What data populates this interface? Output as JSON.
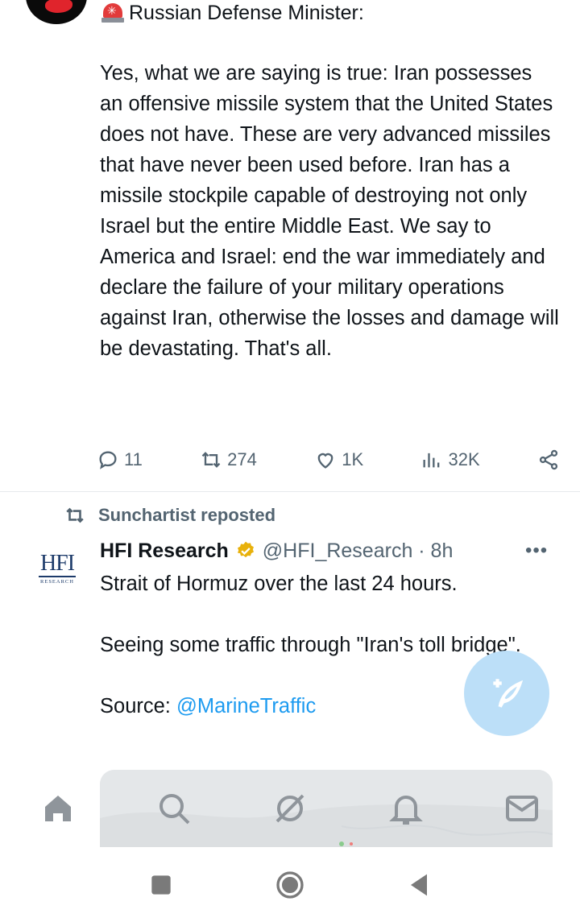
{
  "tweet1": {
    "author_line": "Russian Defense Minister:",
    "body": "Yes, what we are saying is true: Iran possesses an offensive missile system that the United States does not have. These are very advanced missiles that have never been used before. Iran has a missile stockpile capable of destroying not only Israel but the entire Middle East. We say to America and Israel: end the war immediately and declare the failure of your military operations against Iran, otherwise the losses and damage will be devastating. That's all.",
    "replies": "11",
    "reposts": "274",
    "likes": "1K",
    "views": "32K"
  },
  "tweet2": {
    "repost_label": "Sunchartist reposted",
    "name": "HFI Research",
    "handle": "@HFI_Research · 8h",
    "logo_text": "HFI",
    "logo_sub": "RESEARCH",
    "body_line1": "Strait of Hormuz over the last 24 hours.",
    "body_line2": "Seeing some traffic through \"Iran's toll bridge\".",
    "source_label": "Source: ",
    "source_mention": "@MarineTraffic"
  },
  "colors": {
    "text": "#0f1419",
    "secondary": "#536471",
    "accent": "#1d9bf0",
    "fab": "#bcdff8"
  },
  "icons": [
    "siren-icon",
    "reply-icon",
    "repost-icon",
    "like-icon",
    "views-icon",
    "share-icon",
    "verified-icon",
    "more-icon",
    "compose-icon",
    "home-icon",
    "search-icon",
    "grok-icon",
    "notifications-icon",
    "messages-icon",
    "recents-icon",
    "home-circle-icon",
    "back-icon"
  ]
}
